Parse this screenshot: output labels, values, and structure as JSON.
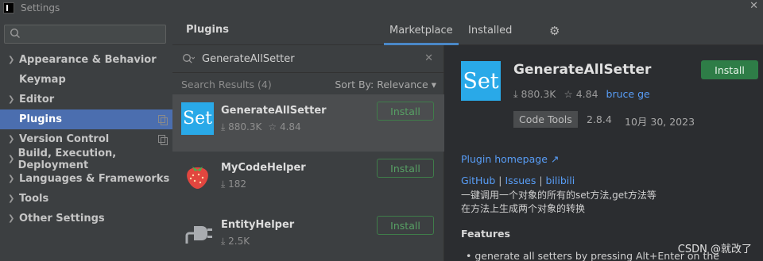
{
  "window": {
    "title": "Settings"
  },
  "sidebar": {
    "items": [
      {
        "label": "Appearance & Behavior",
        "expandable": true
      },
      {
        "label": "Keymap",
        "expandable": false
      },
      {
        "label": "Editor",
        "expandable": true
      },
      {
        "label": "Plugins",
        "expandable": false,
        "selected": true
      },
      {
        "label": "Version Control",
        "expandable": true
      },
      {
        "label": "Build, Execution, Deployment",
        "expandable": true
      },
      {
        "label": "Languages & Frameworks",
        "expandable": true
      },
      {
        "label": "Tools",
        "expandable": true
      },
      {
        "label": "Other Settings",
        "expandable": true
      }
    ]
  },
  "header": {
    "title": "Plugins",
    "tabs": [
      {
        "label": "Marketplace",
        "active": true
      },
      {
        "label": "Installed",
        "active": false
      }
    ]
  },
  "search": {
    "query": "GenerateAllSetter"
  },
  "results": {
    "count_label": "Search Results (4)",
    "sort_label": "Sort By: Relevance"
  },
  "plugins": [
    {
      "name": "GenerateAllSetter",
      "downloads": "880.3K",
      "rating": "4.84",
      "install_label": "Install",
      "logo": "Set"
    },
    {
      "name": "MyCodeHelper",
      "downloads": "182",
      "rating": "",
      "install_label": "Install",
      "logo": "strawberry-icon"
    },
    {
      "name": "EntityHelper",
      "downloads": "2.5K",
      "rating": "",
      "install_label": "Install",
      "logo": "plug-icon"
    }
  ],
  "detail": {
    "name": "GenerateAllSetter",
    "logo": "Set",
    "downloads": "880.3K",
    "rating": "4.84",
    "vendor": "bruce ge",
    "install_label": "Install",
    "tag": "Code Tools",
    "version": "2.8.4",
    "date": "10月 30, 2023",
    "homepage": "Plugin homepage ↗",
    "links": [
      "GitHub",
      "Issues",
      "bilibili"
    ],
    "desc_line1": "一键调用一个对象的所有的set方法,get方法等",
    "desc_line2": "在方法上生成两个对象的转换",
    "features_title": "Features",
    "feature_1": "generate all setters by pressing Alt+Enter on the"
  },
  "watermark": "CSDN @就改了"
}
